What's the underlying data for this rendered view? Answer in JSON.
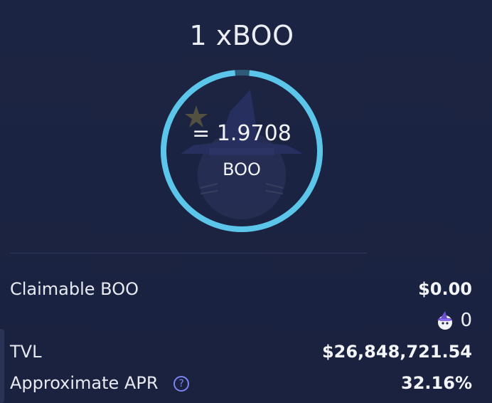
{
  "header": {
    "title": "1 xBOO"
  },
  "ring": {
    "ratio_text": "= 1.9708",
    "unit": "BOO",
    "accent": "#5cc6ea",
    "track": "#2e5a78"
  },
  "stats": {
    "claimable_label": "Claimable BOO",
    "claimable_value": "$0.00",
    "reward_amount": "0",
    "reward_icon": "ghost-wizard-icon",
    "tvl_label": "TVL",
    "tvl_value": "$26,848,721.54",
    "apr_label": "Approximate APR",
    "apr_help": "?",
    "apr_value": "32.16%"
  }
}
